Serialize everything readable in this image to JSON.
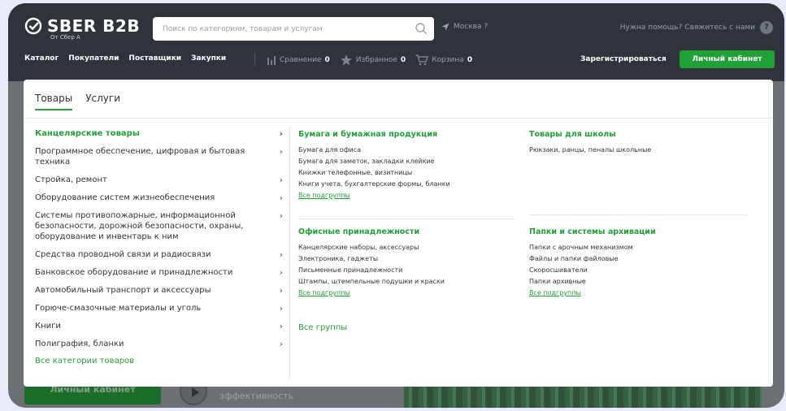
{
  "header": {
    "logo_text": "SBER B2B",
    "logo_sub": "От Сбер А",
    "search_placeholder": "Поиск по категориям, товарам и услугам",
    "city": "Москва ?",
    "help": "Нужна помощь? Свяжитесь с нами",
    "help_badge": "?",
    "nav": [
      "Каталог",
      "Покупатели",
      "Поставщики",
      "Закупки"
    ],
    "tools": [
      {
        "label": "Сравнение",
        "count": "0",
        "icon": "compare-icon"
      },
      {
        "label": "Избранное",
        "count": "0",
        "icon": "star-icon"
      },
      {
        "label": "Корзина",
        "count": "0",
        "icon": "cart-icon"
      }
    ],
    "register": "Зарегистрироваться",
    "cabinet": "Личный кабинет"
  },
  "background": {
    "button": "Личный кабинет",
    "text": "эффективность"
  },
  "dropdown": {
    "tabs": [
      "Товары",
      "Услуги"
    ],
    "categories": [
      "Канцелярские товары",
      "Программное обеспечение, цифровая и бытовая техника",
      "Стройка, ремонт",
      "Оборудование систем жизнеобеспечения",
      "Системы противопожарные, информационной безопасности, дорожной безопасности, охраны, оборудование и инвентарь к ним",
      "Средства проводной связи и радиосвязи",
      "Банковское оборудование и принадлежности",
      "Автомобильный транспорт и аксессуары",
      "Горюче-смазочные материалы и уголь",
      "Книги",
      "Полиграфия, бланки"
    ],
    "all_categories": "Все категории товаров",
    "groups": [
      {
        "title": "Бумага и бумажная продукция",
        "items": [
          "Бумага для офиса",
          "Бумага для заметок, закладки клейкие",
          "Книжки телефонные, визитницы",
          "Книги учета, бухгалтерские формы, бланки"
        ],
        "more": "Все подгруппы"
      },
      {
        "title": "Товары для школы",
        "items": [
          "Рюкзаки, ранцы, пеналы школьные"
        ],
        "more": ""
      },
      {
        "title": "Офисные принадлежности",
        "items": [
          "Канцелярские наборы, аксессуары",
          "Электроника, гаджеты",
          "Письменные принадлежности",
          "Штампы, штемпельные подушки и краски"
        ],
        "more": "Все подгруппы"
      },
      {
        "title": "Папки и системы архивации",
        "items": [
          "Папки с арочным механизмом",
          "Файлы и папки файловые",
          "Скоросшиватели",
          "Папки архивные"
        ],
        "more": "Все подгруппы"
      }
    ],
    "all_groups": "Все группы"
  },
  "colors": {
    "accent": "#21a038",
    "header_bg": "#2f343c"
  }
}
